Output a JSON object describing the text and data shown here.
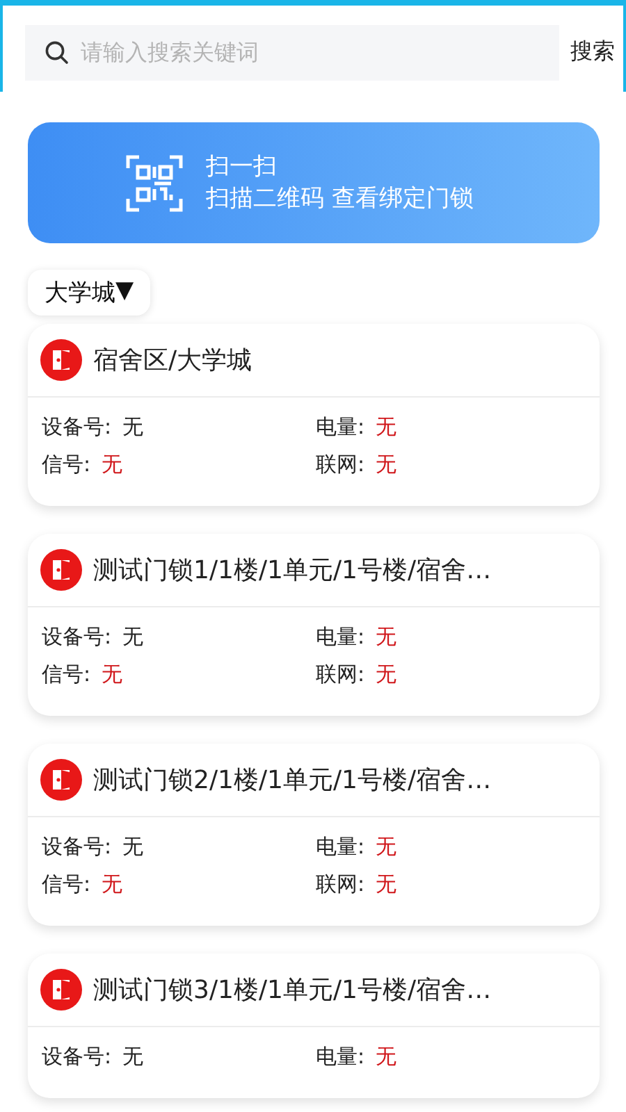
{
  "search": {
    "placeholder": "请输入搜索关键词",
    "button": "搜索"
  },
  "scan_banner": {
    "title": "扫一扫",
    "subtitle": "扫描二维码 查看绑定门锁"
  },
  "area_picker": {
    "label": "大学城",
    "caret": "▼"
  },
  "locks": [
    {
      "name": "宿舍区/大学城",
      "fields": [
        {
          "label": "设备号:",
          "value": "无",
          "alert": false
        },
        {
          "label": "电量:",
          "value": "无",
          "alert": true
        },
        {
          "label": "信号:",
          "value": "无",
          "alert": true
        },
        {
          "label": "联网:",
          "value": "无",
          "alert": true
        }
      ]
    },
    {
      "name": "测试门锁1/1楼/1单元/1号楼/宿舍…",
      "fields": [
        {
          "label": "设备号:",
          "value": "无",
          "alert": false
        },
        {
          "label": "电量:",
          "value": "无",
          "alert": true
        },
        {
          "label": "信号:",
          "value": "无",
          "alert": true
        },
        {
          "label": "联网:",
          "value": "无",
          "alert": true
        }
      ]
    },
    {
      "name": "测试门锁2/1楼/1单元/1号楼/宿舍…",
      "fields": [
        {
          "label": "设备号:",
          "value": "无",
          "alert": false
        },
        {
          "label": "电量:",
          "value": "无",
          "alert": true
        },
        {
          "label": "信号:",
          "value": "无",
          "alert": true
        },
        {
          "label": "联网:",
          "value": "无",
          "alert": true
        }
      ]
    },
    {
      "name": "测试门锁3/1楼/1单元/1号楼/宿舍…",
      "fields": [
        {
          "label": "设备号:",
          "value": "无",
          "alert": false
        },
        {
          "label": "电量:",
          "value": "无",
          "alert": true
        }
      ]
    }
  ]
}
